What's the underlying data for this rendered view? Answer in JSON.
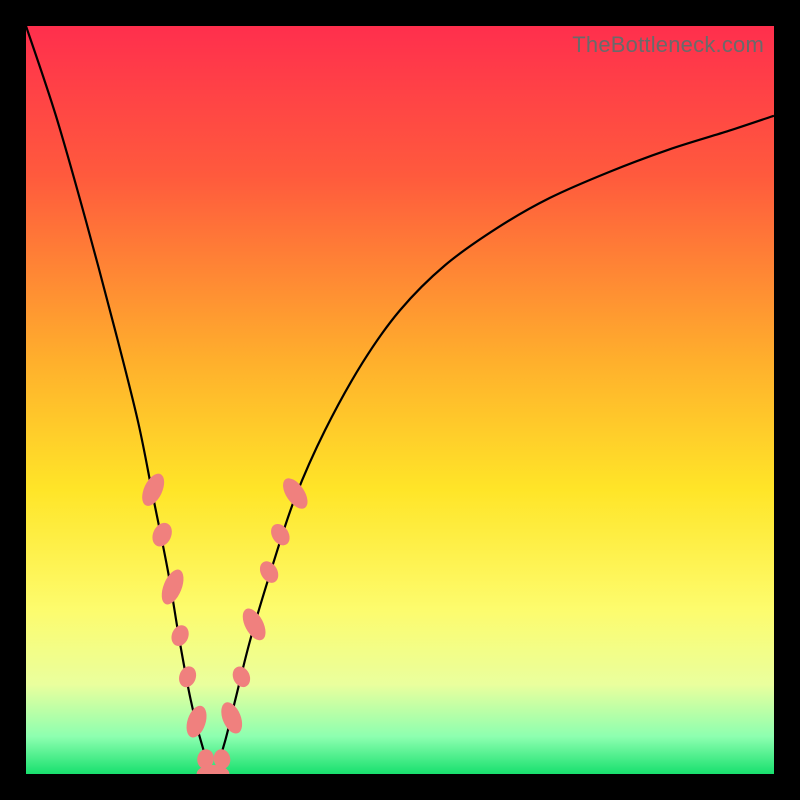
{
  "watermark": "TheBottleneck.com",
  "chart_data": {
    "type": "line",
    "title": "",
    "xlabel": "",
    "ylabel": "",
    "xlim": [
      0,
      100
    ],
    "ylim": [
      0,
      100
    ],
    "grid": false,
    "legend": false,
    "gradient_stops": [
      {
        "pct": 0,
        "color": "#ff2f4d"
      },
      {
        "pct": 20,
        "color": "#ff5a3d"
      },
      {
        "pct": 45,
        "color": "#ffb02c"
      },
      {
        "pct": 62,
        "color": "#ffe528"
      },
      {
        "pct": 78,
        "color": "#fdfc6d"
      },
      {
        "pct": 88,
        "color": "#eaff9d"
      },
      {
        "pct": 95,
        "color": "#8dffb0"
      },
      {
        "pct": 100,
        "color": "#18e06e"
      }
    ],
    "series": [
      {
        "name": "bottleneck-curve",
        "x": [
          0,
          4,
          8,
          12,
          15,
          17,
          19,
          20.5,
          22,
          23.5,
          25,
          26.5,
          28,
          30,
          33,
          36,
          40,
          45,
          50,
          56,
          63,
          70,
          78,
          86,
          94,
          100
        ],
        "values": [
          100,
          88,
          74,
          59,
          47,
          37,
          27,
          18,
          10,
          4,
          0,
          4,
          10,
          18,
          28,
          37,
          46,
          55,
          62,
          68,
          73,
          77,
          80.5,
          83.5,
          86,
          88
        ]
      }
    ],
    "markers": {
      "name": "highlight-dots",
      "color": "#f0807e",
      "points": [
        {
          "x": 17.0,
          "y": 38.0,
          "rx": 2.2,
          "ry": 4.2,
          "rot": 25
        },
        {
          "x": 18.2,
          "y": 32.0,
          "rx": 2.2,
          "ry": 3.0,
          "rot": 25
        },
        {
          "x": 19.6,
          "y": 25.0,
          "rx": 2.2,
          "ry": 4.5,
          "rot": 22
        },
        {
          "x": 20.6,
          "y": 18.5,
          "rx": 2.0,
          "ry": 2.6,
          "rot": 22
        },
        {
          "x": 21.6,
          "y": 13.0,
          "rx": 2.0,
          "ry": 2.6,
          "rot": 20
        },
        {
          "x": 22.8,
          "y": 7.0,
          "rx": 2.2,
          "ry": 4.0,
          "rot": 18
        },
        {
          "x": 24.0,
          "y": 2.0,
          "rx": 2.0,
          "ry": 2.4,
          "rot": 10
        },
        {
          "x": 25.0,
          "y": 0.0,
          "rx": 4.0,
          "ry": 2.2,
          "rot": 0
        },
        {
          "x": 26.2,
          "y": 2.0,
          "rx": 2.0,
          "ry": 2.4,
          "rot": -12
        },
        {
          "x": 27.5,
          "y": 7.5,
          "rx": 2.2,
          "ry": 4.0,
          "rot": -22
        },
        {
          "x": 28.8,
          "y": 13.0,
          "rx": 2.0,
          "ry": 2.6,
          "rot": -25
        },
        {
          "x": 30.5,
          "y": 20.0,
          "rx": 2.2,
          "ry": 4.2,
          "rot": -28
        },
        {
          "x": 32.5,
          "y": 27.0,
          "rx": 2.0,
          "ry": 2.8,
          "rot": -30
        },
        {
          "x": 34.0,
          "y": 32.0,
          "rx": 2.0,
          "ry": 2.8,
          "rot": -32
        },
        {
          "x": 36.0,
          "y": 37.5,
          "rx": 2.2,
          "ry": 4.2,
          "rot": -34
        }
      ]
    }
  }
}
